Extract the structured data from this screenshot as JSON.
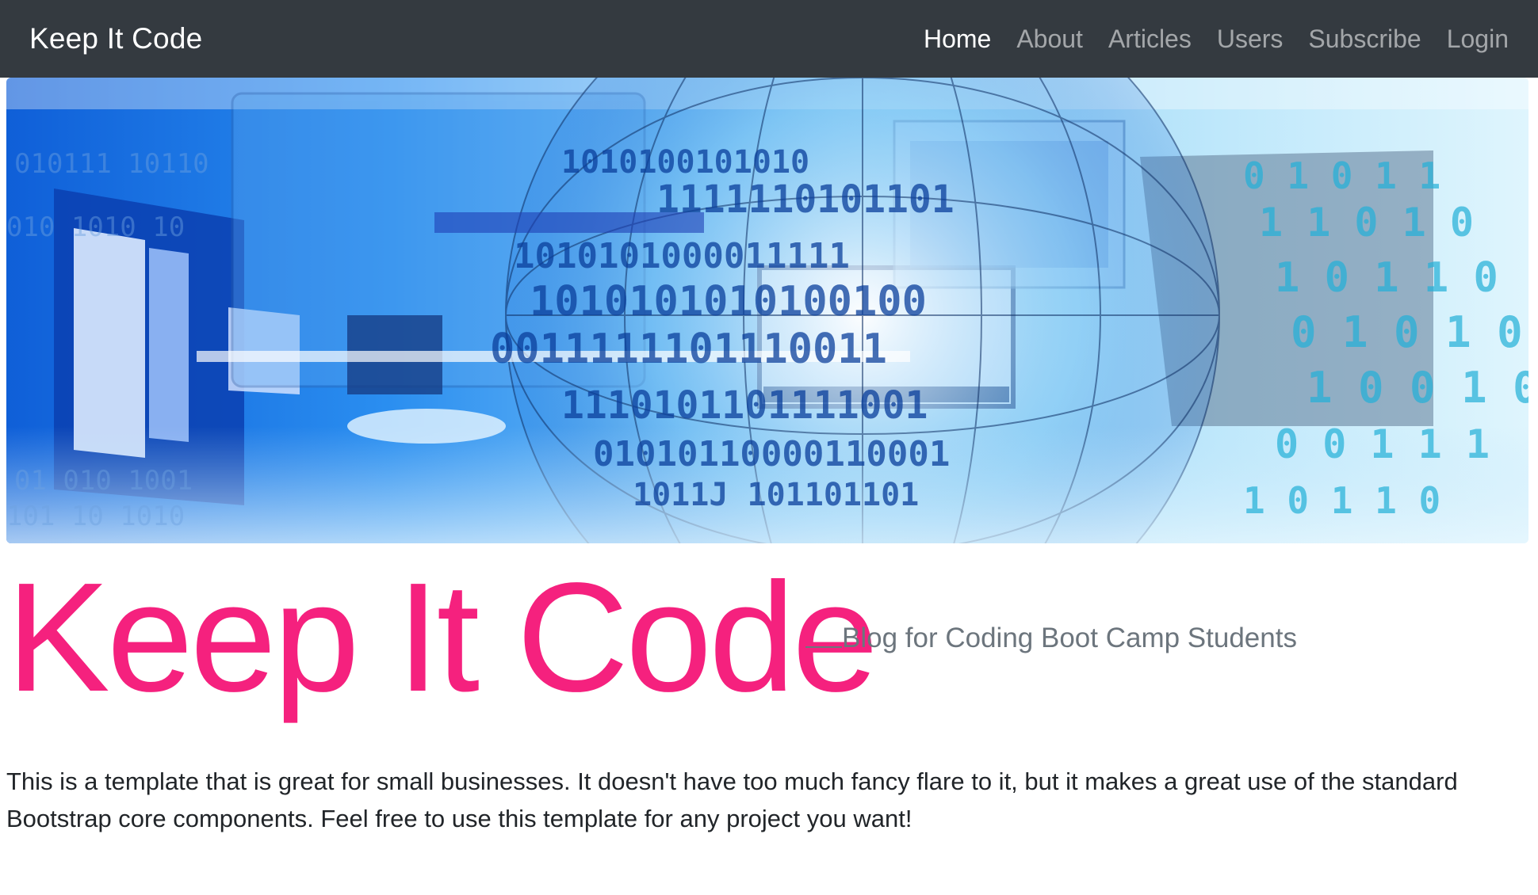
{
  "navbar": {
    "brand": "Keep It Code",
    "items": [
      {
        "label": "Home",
        "active": true
      },
      {
        "label": "About",
        "active": false
      },
      {
        "label": "Articles",
        "active": false
      },
      {
        "label": "Users",
        "active": false
      },
      {
        "label": "Subscribe",
        "active": false
      },
      {
        "label": "Login",
        "active": false
      }
    ]
  },
  "hero": {
    "binary_glyphs": [
      "0",
      "1"
    ]
  },
  "main": {
    "title": "Keep It Code",
    "subtitle": "Blog for Coding Boot Camp Students",
    "body": "This is a template that is great for small businesses. It doesn't have too much fancy flare to it, but it makes a great use of the standard Bootstrap core components. Feel free to use this template for any project you want!"
  },
  "colors": {
    "navbar_bg": "#343a40",
    "title_pink": "#f5217e",
    "subtitle_gray": "#6c757d",
    "hero_blue": "#1e7fe6"
  }
}
